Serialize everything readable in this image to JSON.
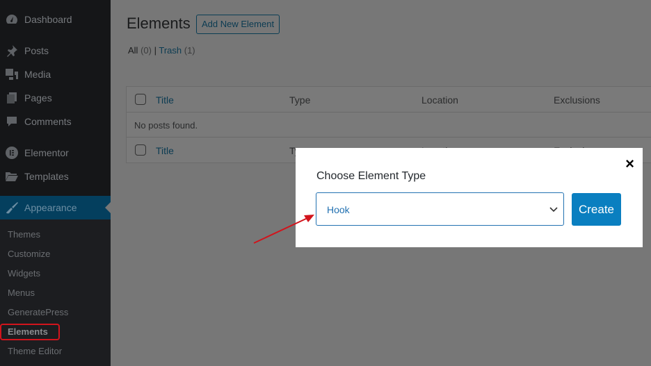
{
  "sidebar": {
    "items": [
      {
        "label": "Dashboard",
        "icon": "dashboard-icon"
      },
      {
        "label": "Posts",
        "icon": "pin-icon"
      },
      {
        "label": "Media",
        "icon": "media-icon"
      },
      {
        "label": "Pages",
        "icon": "pages-icon"
      },
      {
        "label": "Comments",
        "icon": "comment-icon"
      },
      {
        "label": "Elementor",
        "icon": "elementor-icon"
      },
      {
        "label": "Templates",
        "icon": "folder-icon"
      },
      {
        "label": "Appearance",
        "icon": "paintbrush-icon",
        "active": true
      }
    ],
    "submenu": [
      "Themes",
      "Customize",
      "Widgets",
      "Menus",
      "GeneratePress",
      "Elements",
      "Theme Editor"
    ],
    "current_submenu": "Elements"
  },
  "main": {
    "title": "Elements",
    "add_new_label": "Add New Element",
    "filters": {
      "all_label": "All",
      "all_count": "(0)",
      "separator": "|",
      "trash_label": "Trash",
      "trash_count": "(1)"
    },
    "table": {
      "columns": [
        "Title",
        "Type",
        "Location",
        "Exclusions"
      ],
      "empty_message": "No posts found."
    }
  },
  "modal": {
    "title": "Choose Element Type",
    "select_value": "Hook",
    "create_label": "Create",
    "close_label": "×"
  },
  "colors": {
    "accent": "#0a7fc0",
    "highlight": "#d2141c",
    "sidebar": "#151618",
    "active_menu": "#043f5e"
  }
}
